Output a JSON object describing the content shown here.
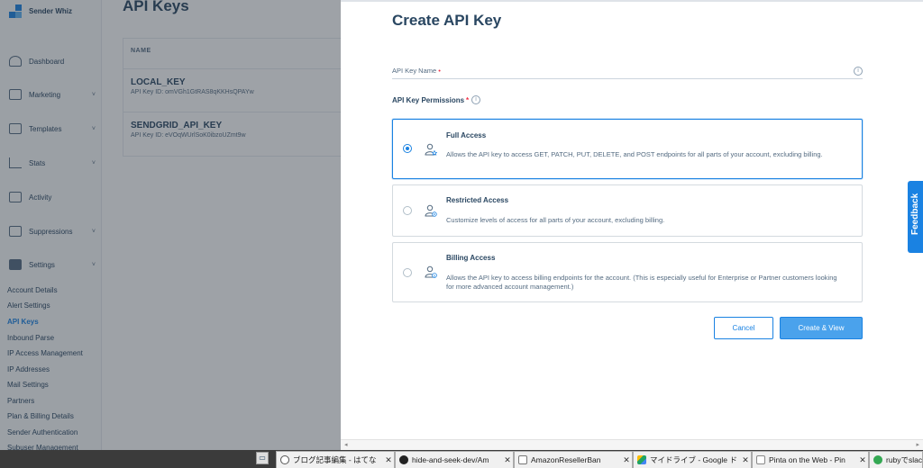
{
  "sidebar": {
    "brand": "Sender Whiz",
    "items": [
      {
        "label": "Dashboard",
        "chevron": ""
      },
      {
        "label": "Marketing",
        "chevron": "˅"
      },
      {
        "label": "Templates",
        "chevron": "˅"
      },
      {
        "label": "Stats",
        "chevron": "˅"
      },
      {
        "label": "Activity",
        "chevron": ""
      },
      {
        "label": "Suppressions",
        "chevron": "˅"
      },
      {
        "label": "Settings",
        "chevron": "˅"
      }
    ],
    "settings_sub": [
      "Account Details",
      "Alert Settings",
      "API Keys",
      "Inbound Parse",
      "IP Access Management",
      "IP Addresses",
      "Mail Settings",
      "Partners",
      "Plan & Billing Details",
      "Sender Authentication",
      "Subuser Management"
    ]
  },
  "main": {
    "title": "API Keys",
    "column_name": "NAME",
    "keys": [
      {
        "name": "LOCAL_KEY",
        "id": "API Key ID: omVGh1GtRAS8qKKHsQPAYw"
      },
      {
        "name": "SENDGRID_API_KEY",
        "id": "API Key ID: eVOqWUrlSoK0ibzoUZmt9w"
      }
    ]
  },
  "modal": {
    "title": "Create API Key",
    "name_label": "API Key Name",
    "name_value": "",
    "required_mark": "•",
    "permissions_label": "API Key Permissions",
    "permissions_required": "*",
    "options": [
      {
        "title": "Full Access",
        "desc": "Allows the API key to access GET, PATCH, PUT, DELETE, and POST endpoints for all parts of your account, excluding billing.",
        "selected": true
      },
      {
        "title": "Restricted Access",
        "desc": "Customize levels of access for all parts of your account, excluding billing.",
        "selected": false
      },
      {
        "title": "Billing Access",
        "desc": "Allows the API key to access billing endpoints for the account. (This is especially useful for Enterprise or Partner customers looking for more advanced account management.)",
        "selected": false
      }
    ],
    "cancel_label": "Cancel",
    "create_label": "Create & View"
  },
  "feedback_label": "Feedback",
  "taskbar": {
    "tabs": [
      {
        "label": "ブログ記事編集 - はてな",
        "fav_color": "#ffffff"
      },
      {
        "label": "hide-and-seek-dev/Am",
        "fav_color": "#222222"
      },
      {
        "label": "AmazonResellerBan",
        "fav_color": "#ffffff"
      },
      {
        "label": "マイドライブ - Google ド",
        "fav_color": "#1fa463"
      },
      {
        "label": "Pinta on the Web - Pin",
        "fav_color": "#ffffff"
      },
      {
        "label": "rubyでslac",
        "fav_color": "#34a853"
      }
    ]
  },
  "colors": {
    "accent": "#1a82e2",
    "text": "#294661",
    "muted": "#546b81",
    "required": "#f22f46"
  }
}
